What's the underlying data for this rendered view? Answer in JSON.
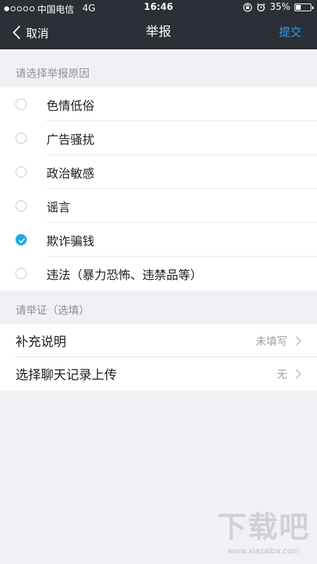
{
  "status_bar": {
    "carrier": "中国电信",
    "network": "4G",
    "time": "16:46",
    "battery": "35%",
    "battery_level": 0.35
  },
  "nav": {
    "back_label": "取消",
    "title": "举报",
    "submit_label": "提交"
  },
  "reasons_section": {
    "header": "请选择举报原因",
    "options": [
      {
        "label": "色情低俗",
        "checked": false
      },
      {
        "label": "广告骚扰",
        "checked": false
      },
      {
        "label": "政治敏感",
        "checked": false
      },
      {
        "label": "谣言",
        "checked": false
      },
      {
        "label": "欺诈骗钱",
        "checked": true
      },
      {
        "label": "违法（暴力恐怖、违禁品等）",
        "checked": false
      }
    ]
  },
  "evidence_section": {
    "header": "请举证（选填）",
    "rows": [
      {
        "label": "补充说明",
        "value": "未填写"
      },
      {
        "label": "选择聊天记录上传",
        "value": "无"
      }
    ]
  },
  "watermark": {
    "logo": "下载吧",
    "url": "www.xiazaiba.com"
  },
  "colors": {
    "nav_bg": "#2c3036",
    "accent": "#2d9ce8",
    "checked": "#22a7e8",
    "page_bg": "#f1f1f5"
  }
}
